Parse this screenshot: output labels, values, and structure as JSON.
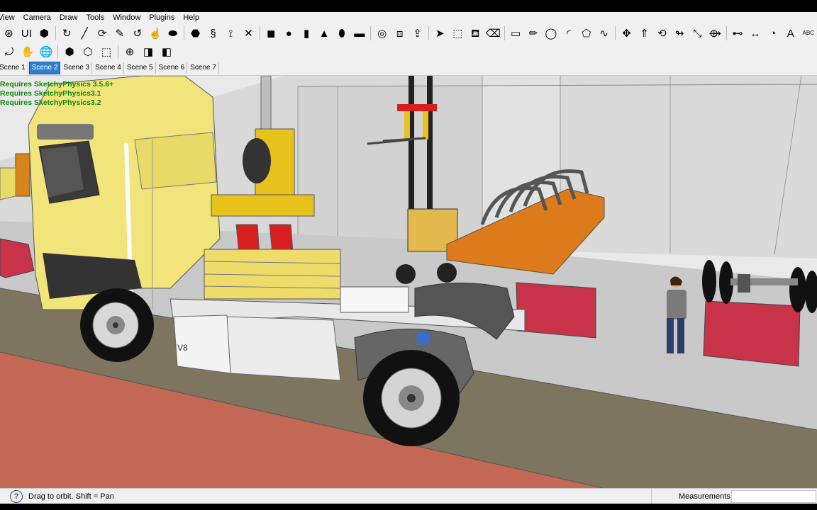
{
  "menu": [
    "View",
    "Camera",
    "Draw",
    "Tools",
    "Window",
    "Plugins",
    "Help"
  ],
  "toolbar1": [
    {
      "icon": "orbit-icon",
      "glyph": "⊛"
    },
    {
      "icon": "ui-icon",
      "glyph": "UI"
    },
    {
      "icon": "physics-icon",
      "glyph": "⬢"
    },
    {
      "icon": "sep"
    },
    {
      "icon": "rotate-icon",
      "glyph": "↻"
    },
    {
      "icon": "line-icon",
      "glyph": "╱"
    },
    {
      "icon": "offset-icon",
      "glyph": "⟳"
    },
    {
      "icon": "pencil-icon",
      "glyph": "✎"
    },
    {
      "icon": "refresh-icon",
      "glyph": "↺"
    },
    {
      "icon": "hand-icon",
      "glyph": "☝"
    },
    {
      "icon": "ellipse-icon",
      "glyph": "⬬"
    },
    {
      "icon": "sep"
    },
    {
      "icon": "gem-icon",
      "glyph": "⬣"
    },
    {
      "icon": "spring-icon",
      "glyph": "§"
    },
    {
      "icon": "magnet-icon",
      "glyph": "⟟"
    },
    {
      "icon": "cross-icon",
      "glyph": "✕"
    },
    {
      "icon": "sep"
    },
    {
      "icon": "box-icon",
      "glyph": "◼"
    },
    {
      "icon": "sphere-icon",
      "glyph": "●"
    },
    {
      "icon": "cylinder-icon",
      "glyph": "▮"
    },
    {
      "icon": "cone-icon",
      "glyph": "▲"
    },
    {
      "icon": "capsule-icon",
      "glyph": "⬮"
    },
    {
      "icon": "slab-icon",
      "glyph": "▬"
    },
    {
      "icon": "sep"
    },
    {
      "icon": "torus-icon",
      "glyph": "◎"
    },
    {
      "icon": "cubes-icon",
      "glyph": "⧈"
    },
    {
      "icon": "upload-icon",
      "glyph": "⇪"
    },
    {
      "icon": "sep"
    },
    {
      "icon": "select-icon",
      "glyph": "➤"
    },
    {
      "icon": "component-icon",
      "glyph": "⬚"
    },
    {
      "icon": "paint-bucket-icon",
      "glyph": "⛾"
    },
    {
      "icon": "eraser-icon",
      "glyph": "⌫"
    },
    {
      "icon": "sep"
    },
    {
      "icon": "rectangle-icon",
      "glyph": "▭"
    },
    {
      "icon": "pencil-line-icon",
      "glyph": "✏"
    },
    {
      "icon": "circle-icon",
      "glyph": "◯"
    },
    {
      "icon": "arc-icon",
      "glyph": "◜"
    },
    {
      "icon": "polygon-icon",
      "glyph": "⬠"
    },
    {
      "icon": "freehand-icon",
      "glyph": "∿"
    },
    {
      "icon": "sep"
    },
    {
      "icon": "move-icon",
      "glyph": "✥"
    },
    {
      "icon": "push-pull-icon",
      "glyph": "⇑"
    },
    {
      "icon": "rotate-tool-icon",
      "glyph": "⟲"
    },
    {
      "icon": "follow-me-icon",
      "glyph": "↬"
    },
    {
      "icon": "scale-icon",
      "glyph": "⤡"
    },
    {
      "icon": "offset-tool-icon",
      "glyph": "⟴"
    },
    {
      "icon": "sep"
    },
    {
      "icon": "tape-measure-icon",
      "glyph": "⊷"
    },
    {
      "icon": "dimension-icon",
      "glyph": "↔"
    },
    {
      "icon": "protractor-icon",
      "glyph": "◔"
    },
    {
      "icon": "text-icon",
      "glyph": "A"
    },
    {
      "icon": "label-icon",
      "glyph": "ABC"
    }
  ],
  "toolbar2": [
    {
      "icon": "orbit-camera-icon",
      "glyph": "⤾"
    },
    {
      "icon": "pan-icon",
      "glyph": "✋"
    },
    {
      "icon": "globe-icon",
      "glyph": "🌐"
    },
    {
      "icon": "sep"
    },
    {
      "icon": "component-a-icon",
      "glyph": "⬢"
    },
    {
      "icon": "component-b-icon",
      "glyph": "⬡"
    },
    {
      "icon": "component-c-icon",
      "glyph": "⬚"
    },
    {
      "icon": "sep"
    },
    {
      "icon": "axes-icon",
      "glyph": "⊕"
    },
    {
      "icon": "section-plane-icon",
      "glyph": "◨"
    },
    {
      "icon": "section-fill-icon",
      "glyph": "◧"
    }
  ],
  "scenes": [
    "Scene 1",
    "Scene 2",
    "Scene 3",
    "Scene 4",
    "Scene 5",
    "Scene 6",
    "Scene 7"
  ],
  "active_scene": "Scene 2",
  "overlay_lines": [
    "Requires SketchyPhysics 3.5.6+",
    "Requires SketchyPhysics3.1",
    "Requires SketchyPhysics3.2"
  ],
  "status": {
    "help_glyph": "?",
    "text": "Drag to orbit.  Shift = Pan",
    "measurements_label": "Measurements",
    "measurements_value": ""
  },
  "colors": {
    "accent": "#2e7fd0",
    "truck_body": "#f0e47a",
    "crate_red": "#c8334a",
    "orange_panel": "#dd7a1c",
    "overlay_text": "#0b8a0b",
    "floor": "#7e7560",
    "track": "#c36854"
  }
}
